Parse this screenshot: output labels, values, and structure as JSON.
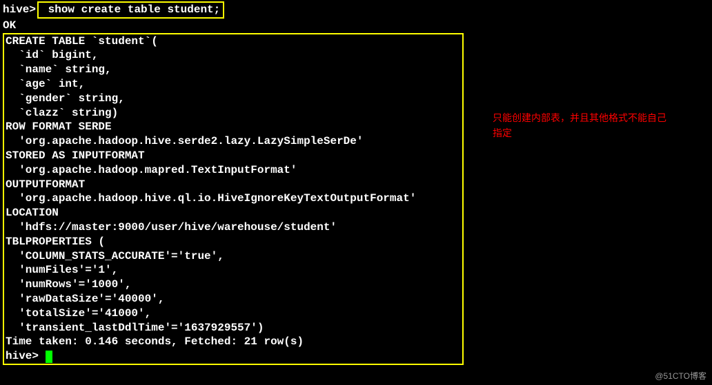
{
  "prompt1": {
    "prefix": "hive>",
    "command": " show create table student;"
  },
  "ok_line": "OK",
  "output_lines": [
    "CREATE TABLE `student`(",
    "  `id` bigint, ",
    "  `name` string, ",
    "  `age` int, ",
    "  `gender` string, ",
    "  `clazz` string)",
    "ROW FORMAT SERDE ",
    "  'org.apache.hadoop.hive.serde2.lazy.LazySimpleSerDe' ",
    "STORED AS INPUTFORMAT ",
    "  'org.apache.hadoop.mapred.TextInputFormat' ",
    "OUTPUTFORMAT ",
    "  'org.apache.hadoop.hive.ql.io.HiveIgnoreKeyTextOutputFormat'",
    "LOCATION",
    "  'hdfs://master:9000/user/hive/warehouse/student'",
    "TBLPROPERTIES (",
    "  'COLUMN_STATS_ACCURATE'='true', ",
    "  'numFiles'='1', ",
    "  'numRows'='1000', ",
    "  'rawDataSize'='40000', ",
    "  'totalSize'='41000', ",
    "  'transient_lastDdlTime'='1637929557')",
    "Time taken: 0.146 seconds, Fetched: 21 row(s)",
    "hive> "
  ],
  "annotation": {
    "line1": "只能创建内部表，并且其他格式不能自己",
    "line2": "指定"
  },
  "watermark": "@51CTO博客"
}
